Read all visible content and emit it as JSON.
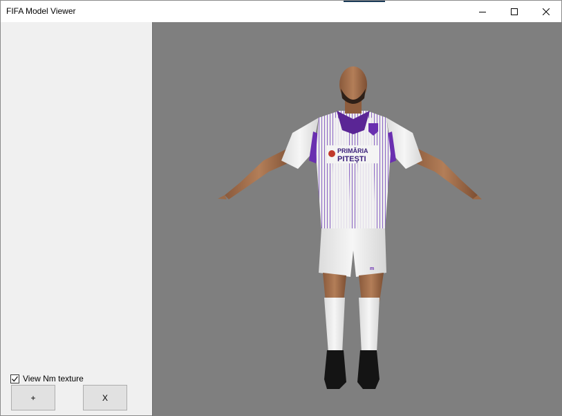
{
  "window": {
    "title": "FIFA Model Viewer"
  },
  "titlebar": {
    "minimize_icon": "minimize-icon",
    "maximize_icon": "maximize-icon",
    "close_icon": "close-icon"
  },
  "sidebar": {
    "checkbox_label": "View Nm texture",
    "checkbox_checked": true,
    "add_button_label": "+",
    "close_button_label": "X"
  },
  "viewport": {
    "background_color": "#7f7f7f",
    "jersey": {
      "sponsor_line1": "PRIMĂRIA",
      "sponsor_line2": "PITEŞTI",
      "kit_color": "#f2f2f2",
      "accent_color": "#6a2fb0"
    }
  }
}
